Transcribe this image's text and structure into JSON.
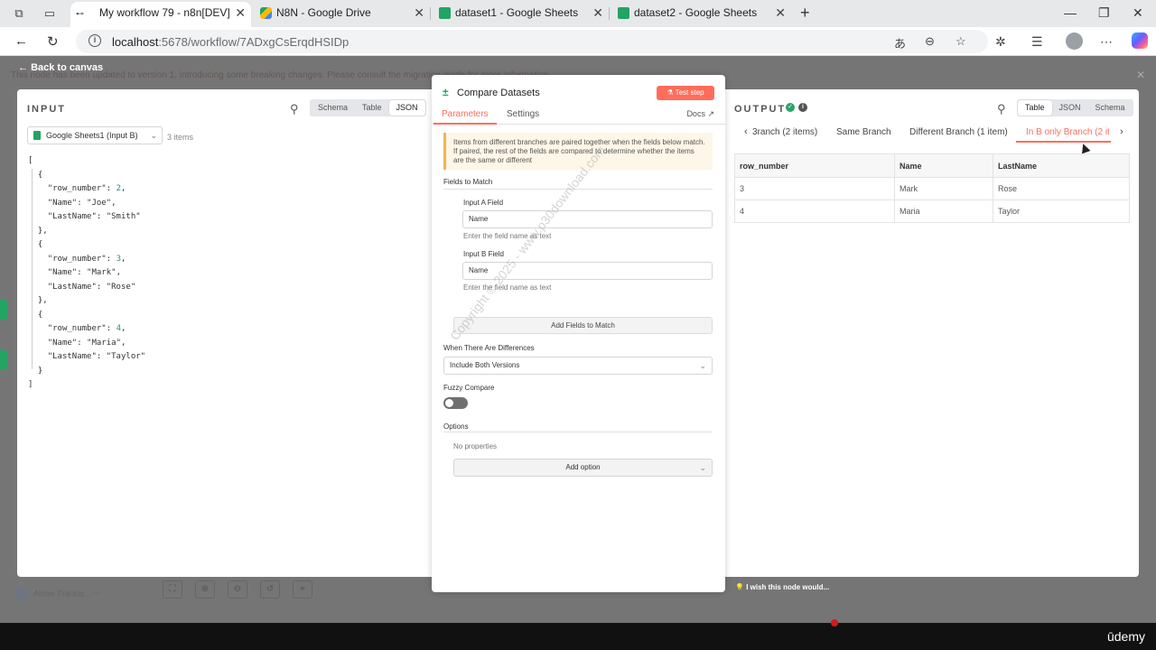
{
  "browser": {
    "tabs": [
      {
        "label": "My workflow 79 - n8n[DEV]",
        "icon": "n8n-icon"
      },
      {
        "label": "N8N - Google Drive",
        "icon": "google-drive-icon"
      },
      {
        "label": "dataset1 - Google Sheets",
        "icon": "google-sheets-icon"
      },
      {
        "label": "dataset2 - Google Sheets",
        "icon": "google-sheets-icon"
      }
    ],
    "url_host": "localhost",
    "url_rest": ":5678/workflow/7ADxgCsErqdHSIDp"
  },
  "app": {
    "back_label": "Back to canvas",
    "banner_text": "This node has been updated to version 1, introducing some breaking changes. Please consult the migration guide for more information."
  },
  "input": {
    "title": "INPUT",
    "views": [
      "Schema",
      "Table",
      "JSON"
    ],
    "active_view": "JSON",
    "source": "Google Sheets1 (Input B)",
    "item_count": "3 items",
    "items": [
      {
        "row_number": 2,
        "Name": "Joe",
        "LastName": "Smith"
      },
      {
        "row_number": 3,
        "Name": "Mark",
        "LastName": "Rose"
      },
      {
        "row_number": 4,
        "Name": "Maria",
        "LastName": "Taylor"
      }
    ]
  },
  "node": {
    "title": "Compare Datasets",
    "test_label": "Test step",
    "tabs": [
      "Parameters",
      "Settings"
    ],
    "active_tab": "Parameters",
    "docs_label": "Docs",
    "notice": "Items from different branches are paired together when the fields below match. If paired, the rest of the fields are compared to determine whether the items are the same or different",
    "fields_to_match_label": "Fields to Match",
    "input_a_label": "Input A Field",
    "input_a_value": "Name",
    "input_a_hint": "Enter the field name as text",
    "input_b_label": "Input B Field",
    "input_b_value": "Name",
    "input_b_hint": "Enter the field name as text",
    "add_fields_label": "Add Fields to Match",
    "differences_label": "When There Are Differences",
    "differences_value": "Include Both Versions",
    "fuzzy_label": "Fuzzy Compare",
    "options_label": "Options",
    "no_properties": "No properties",
    "add_option_label": "Add option"
  },
  "output": {
    "title": "OUTPUT",
    "views": [
      "Table",
      "JSON",
      "Schema"
    ],
    "active_view": "Table",
    "branches": [
      "3ranch (2 items)",
      "Same Branch",
      "Different Branch (1 item)",
      "In B only Branch (2 it"
    ],
    "active_branch": "In B only Branch (2 it",
    "columns": [
      "row_number",
      "Name",
      "LastName"
    ],
    "rows": [
      [
        "3",
        "Mark",
        "Rose"
      ],
      [
        "4",
        "Maria",
        "Taylor"
      ]
    ],
    "feedback": "I wish this node would..."
  },
  "canvas": {
    "user_name": "Abner Francis..."
  },
  "watermark": "Copyright © 2025 - www.p30download.com",
  "footer_brand": "ūdemy",
  "colors": {
    "accent": "#ff6d5a",
    "success": "#29a46b",
    "sheets_green": "#22a463"
  }
}
